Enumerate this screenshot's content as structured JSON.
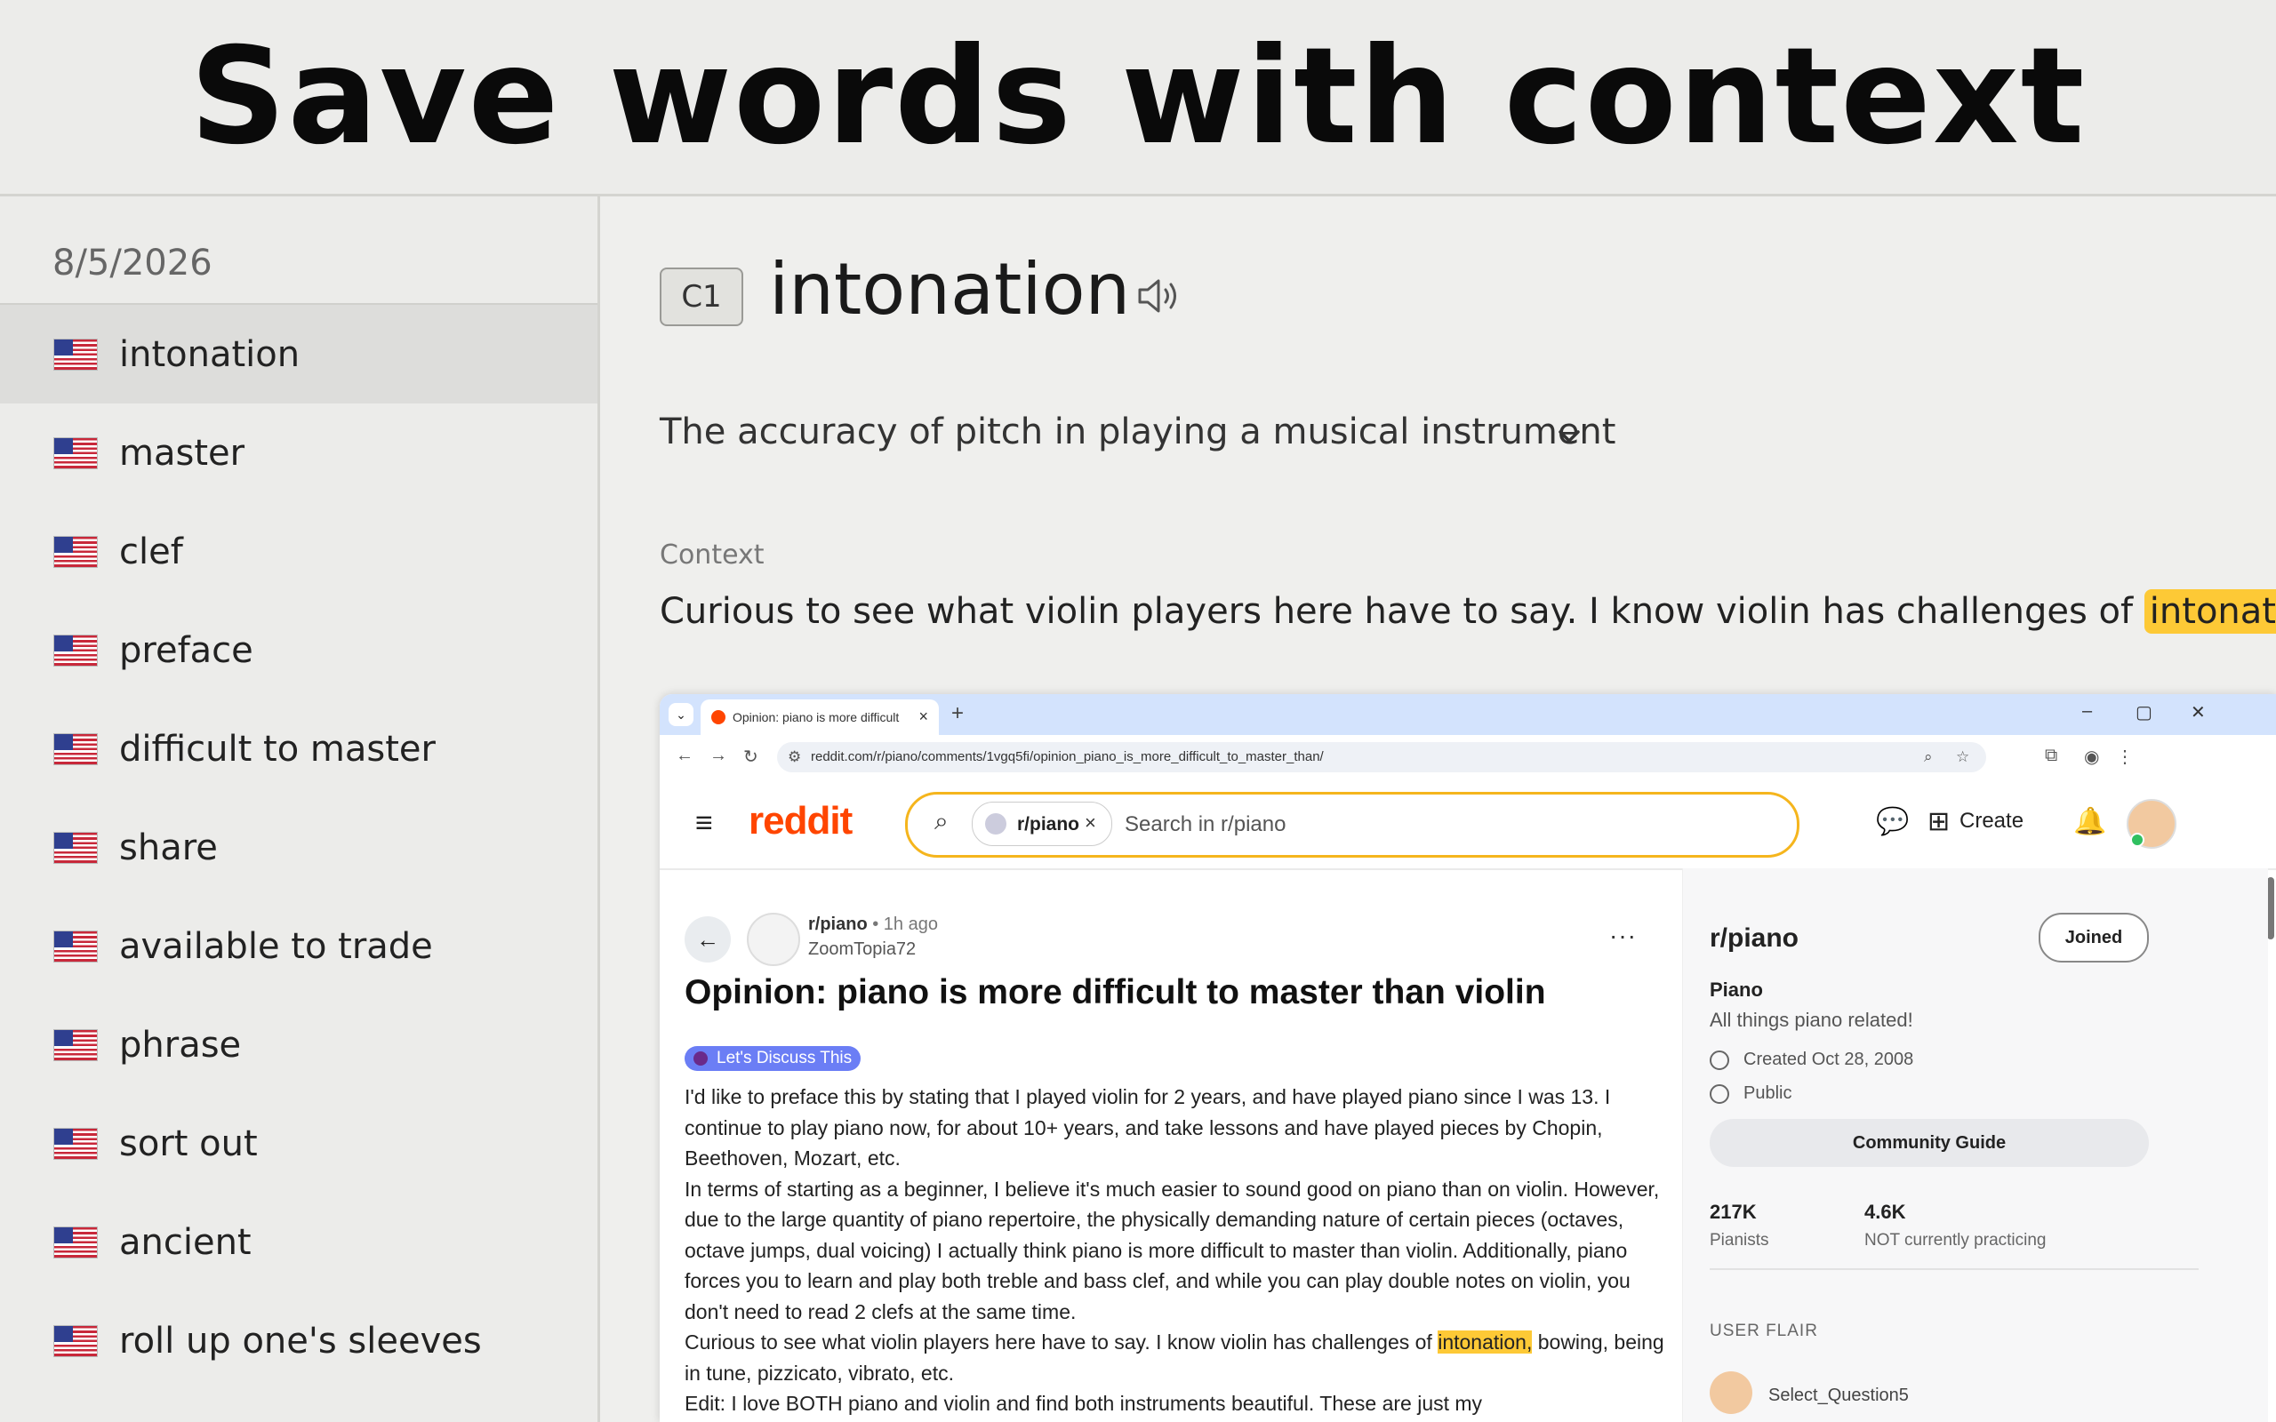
{
  "header": {
    "title": "Save words with context"
  },
  "sidebar": {
    "date": "8/5/2026",
    "items": [
      {
        "label": "intonation",
        "flag": "us-flag-icon",
        "active": true
      },
      {
        "label": "master",
        "flag": "us-flag-icon"
      },
      {
        "label": "clef",
        "flag": "us-flag-icon"
      },
      {
        "label": "preface",
        "flag": "us-flag-icon"
      },
      {
        "label": "difficult to master",
        "flag": "us-flag-icon"
      },
      {
        "label": "share",
        "flag": "us-flag-icon"
      },
      {
        "label": "available to trade",
        "flag": "us-flag-icon"
      },
      {
        "label": "phrase",
        "flag": "us-flag-icon"
      },
      {
        "label": "sort out",
        "flag": "us-flag-icon"
      },
      {
        "label": "ancient",
        "flag": "us-flag-icon"
      },
      {
        "label": "roll up one's sleeves",
        "flag": "us-flag-icon"
      }
    ]
  },
  "detail": {
    "level": "C1",
    "word": "intonation",
    "definition": "The accuracy of pitch in playing a musical instrument",
    "context_label": "Context",
    "context_before": "Curious to see what violin players here have to say. I know violin has challenges of ",
    "context_highlight": "intonation",
    "context_after": ",",
    "highlight_color": "#fdc936"
  },
  "screenshot": {
    "tab_title": "Opinion: piano is more difficult",
    "url": "reddit.com/r/piano/comments/1vgq5fi/opinion_piano_is_more_difficult_to_master_than/",
    "brand": "reddit",
    "brand_color": "#ff4500",
    "search_chip": "r/piano",
    "search_placeholder": "Search in r/piano",
    "create_label": "Create",
    "post": {
      "subreddit": "r/piano",
      "time": "• 1h ago",
      "author": "ZoomTopia72",
      "title": "Opinion: piano is more difficult to master than violin",
      "flair": "Let's Discuss This",
      "p1": "I'd like to preface this by stating that I played violin for 2 years, and have played piano since I was 13. I continue to play piano now, for about 10+ years, and take lessons and have played pieces by Chopin, Beethoven, Mozart, etc.",
      "p2": "In terms of starting as a beginner, I believe it's much easier to sound good on piano than on violin. However, due to the large quantity of piano repertoire, the physically demanding nature of certain pieces (octaves, octave jumps, dual voicing) I actually think piano is more difficult to master than violin. Additionally, piano forces you to learn and play both treble and bass clef, and while you can play double notes on violin, you don't need to read 2 clefs at the same time.",
      "p3_before": "Curious to see what violin players here have to say. I know violin has challenges of ",
      "p3_highlight": "intonation,",
      "p3_after": " bowing, being in tune, pizzicato, vibrato, etc.",
      "p4": "Edit: I love BOTH piano and violin and find both instruments beautiful. These are just my"
    },
    "aside": {
      "name": "r/piano",
      "joined": "Joined",
      "title": "Piano",
      "desc": "All things piano related!",
      "created": "Created Oct 28, 2008",
      "visibility": "Public",
      "guide": "Community Guide",
      "stat1_num": "217K",
      "stat1_lbl": "Pianists",
      "stat2_num": "4.6K",
      "stat2_lbl": "NOT currently practicing",
      "flair_label": "USER FLAIR",
      "flair_user": "Select_Question5"
    }
  }
}
